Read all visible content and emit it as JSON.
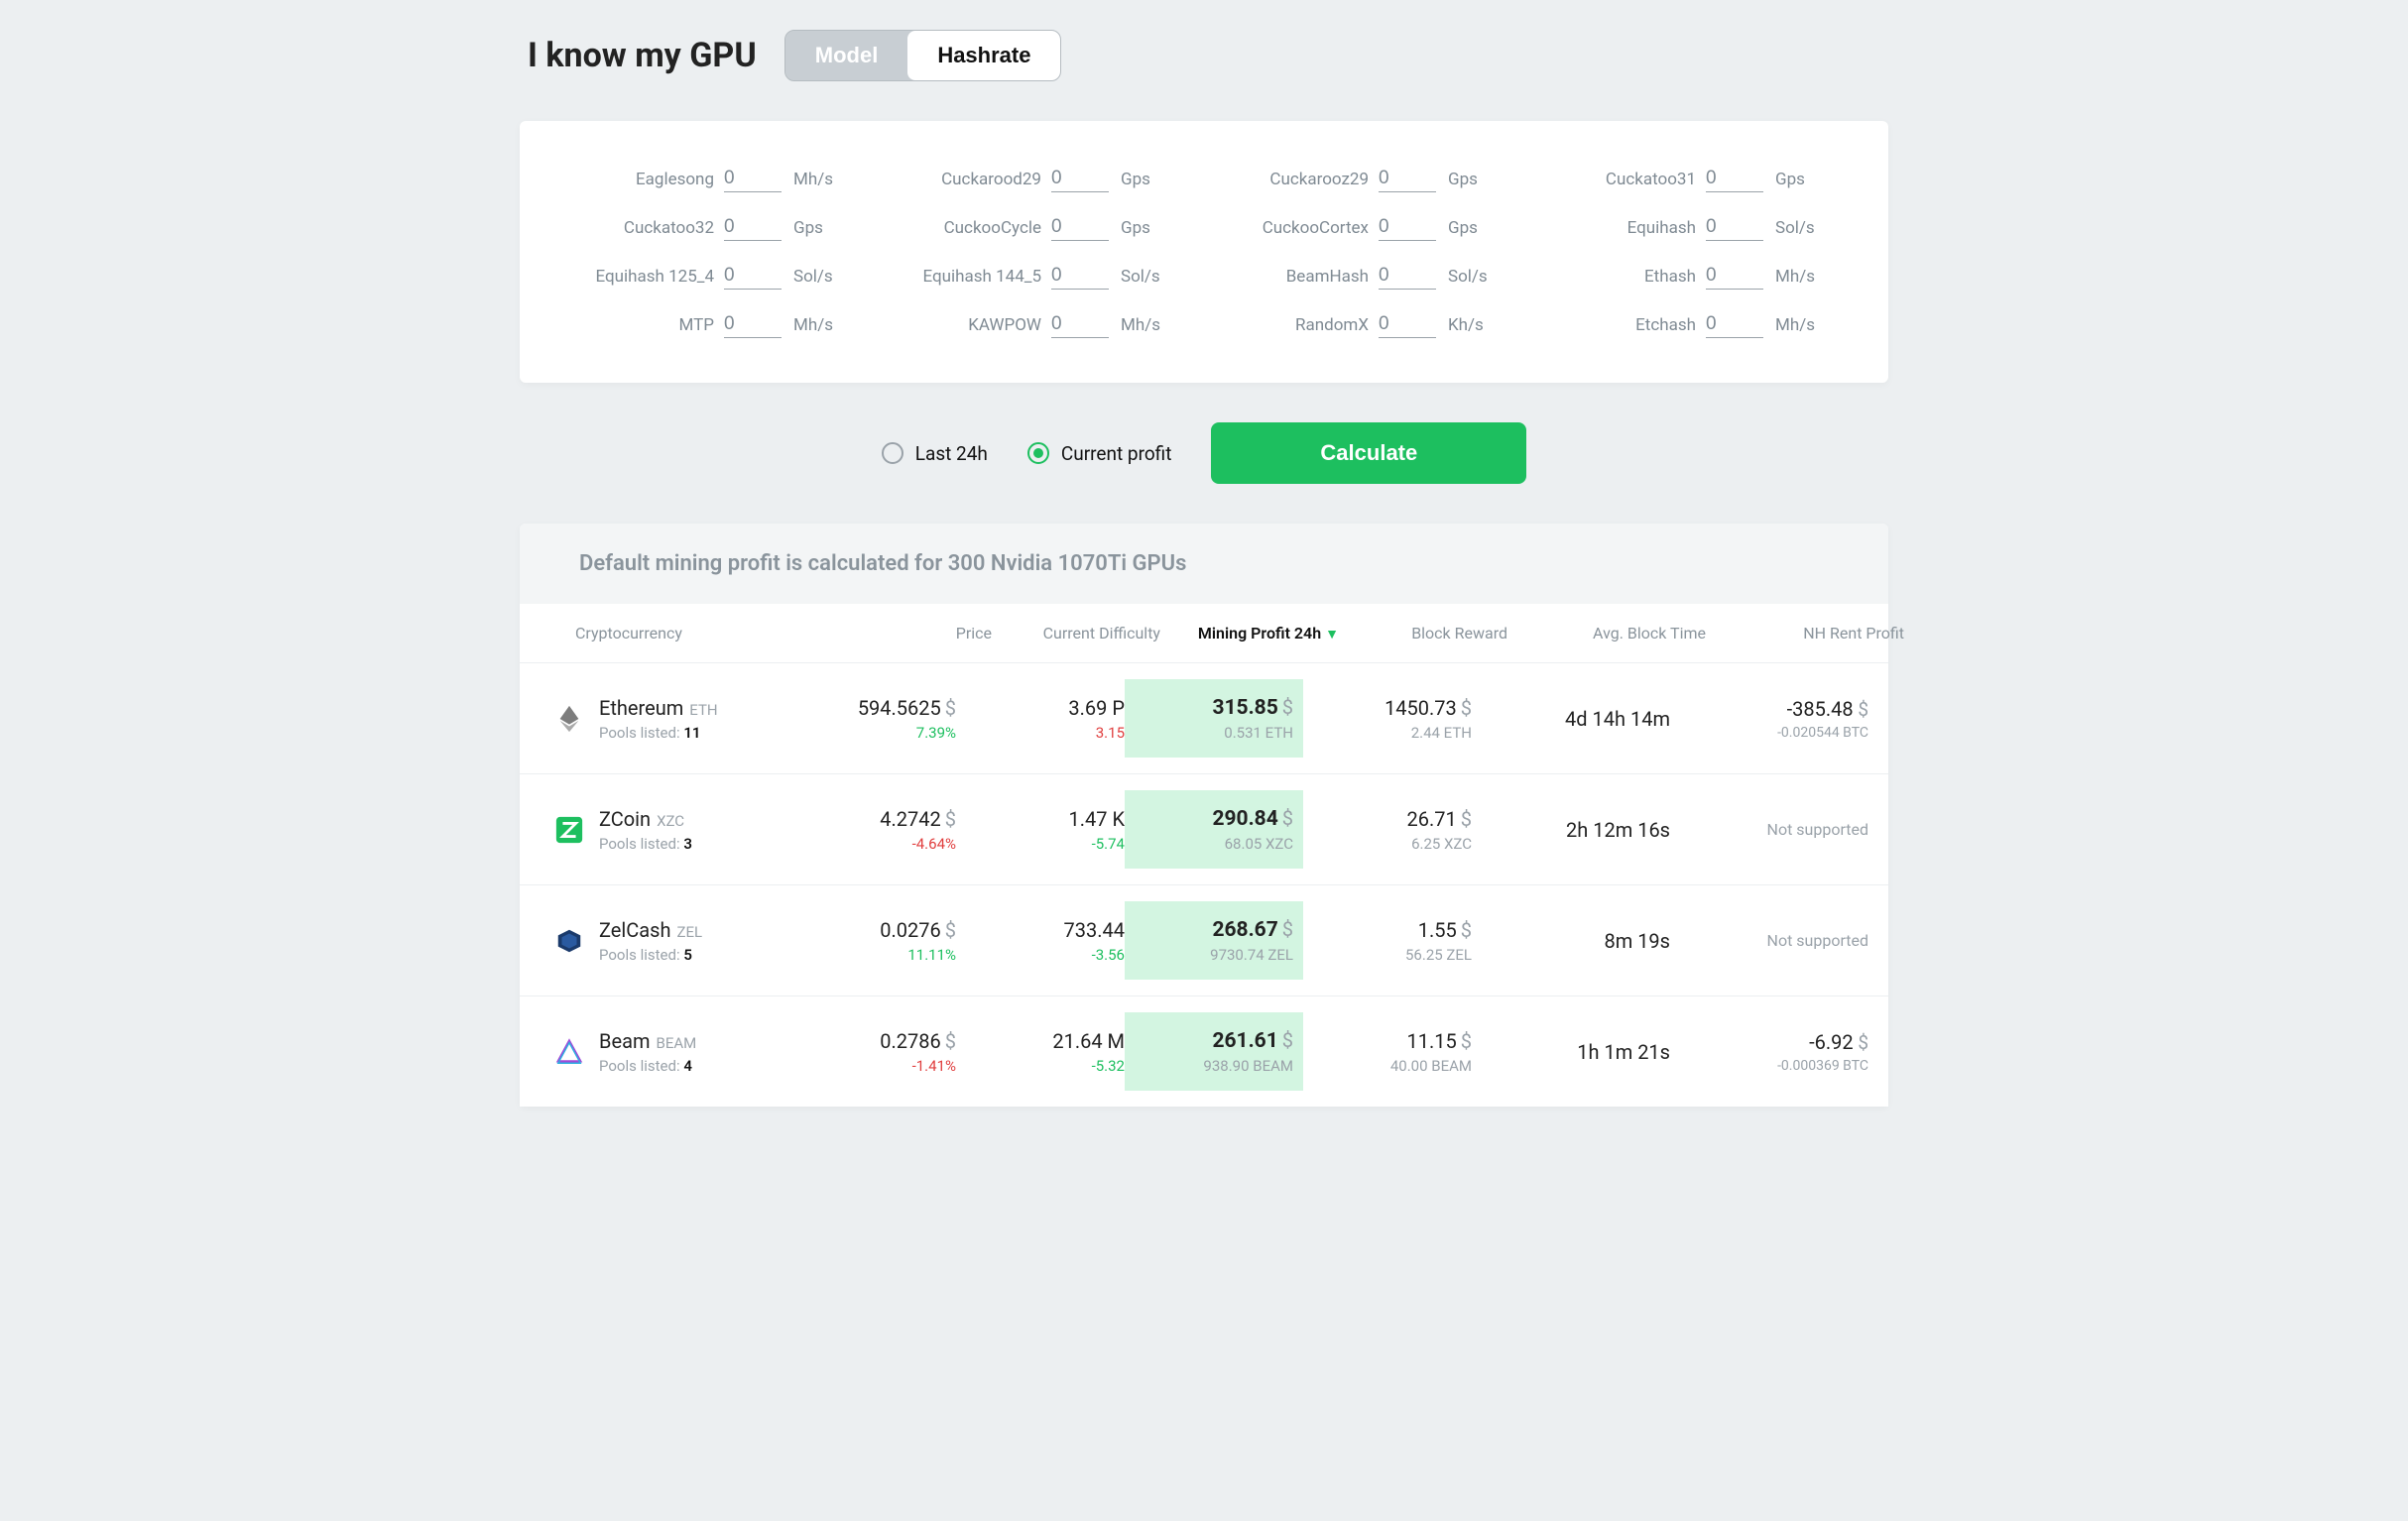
{
  "title": "I know my GPU",
  "toggle": {
    "model": "Model",
    "hashrate": "Hashrate"
  },
  "hashrate_inputs": [
    {
      "label": "Eaglesong",
      "value": "0",
      "unit": "Mh/s"
    },
    {
      "label": "Cuckarood29",
      "value": "0",
      "unit": "Gps"
    },
    {
      "label": "Cuckarooz29",
      "value": "0",
      "unit": "Gps"
    },
    {
      "label": "Cuckatoo31",
      "value": "0",
      "unit": "Gps"
    },
    {
      "label": "Cuckatoo32",
      "value": "0",
      "unit": "Gps"
    },
    {
      "label": "CuckooCycle",
      "value": "0",
      "unit": "Gps"
    },
    {
      "label": "CuckooCortex",
      "value": "0",
      "unit": "Gps"
    },
    {
      "label": "Equihash",
      "value": "0",
      "unit": "Sol/s"
    },
    {
      "label": "Equihash 125_4",
      "value": "0",
      "unit": "Sol/s"
    },
    {
      "label": "Equihash 144_5",
      "value": "0",
      "unit": "Sol/s"
    },
    {
      "label": "BeamHash",
      "value": "0",
      "unit": "Sol/s"
    },
    {
      "label": "Ethash",
      "value": "0",
      "unit": "Mh/s"
    },
    {
      "label": "MTP",
      "value": "0",
      "unit": "Mh/s"
    },
    {
      "label": "KAWPOW",
      "value": "0",
      "unit": "Mh/s"
    },
    {
      "label": "RandomX",
      "value": "0",
      "unit": "Kh/s"
    },
    {
      "label": "Etchash",
      "value": "0",
      "unit": "Mh/s"
    }
  ],
  "radio": {
    "last24h": "Last 24h",
    "current": "Current profit"
  },
  "calculate": "Calculate",
  "info_bar": "Default mining profit is calculated for 300 Nvidia 1070Ti GPUs",
  "columns": {
    "crypto": "Cryptocurrency",
    "price": "Price",
    "difficulty": "Current Difficulty",
    "profit": "Mining Profit 24h",
    "reward": "Block Reward",
    "blocktime": "Avg. Block Time",
    "nhrent": "NH Rent Profit"
  },
  "pools_label": "Pools listed:",
  "not_supported": "Not supported",
  "rows": [
    {
      "name": "Ethereum",
      "sym": "ETH",
      "pools": "11",
      "price": "594.5625",
      "price_change": "7.39%",
      "price_dir": "green",
      "diff": "3.69 P",
      "diff_change": "3.15",
      "diff_dir": "red",
      "profit": "315.85",
      "profit_sub": "0.531 ETH",
      "reward": "1450.73",
      "reward_sub": "2.44 ETH",
      "blocktime": "4d 14h 14m",
      "nh": "-385.48",
      "nh_sub": "-0.020544 BTC",
      "nh_supported": true
    },
    {
      "name": "ZCoin",
      "sym": "XZC",
      "pools": "3",
      "price": "4.2742",
      "price_change": "-4.64%",
      "price_dir": "red",
      "diff": "1.47 K",
      "diff_change": "-5.74",
      "diff_dir": "green",
      "profit": "290.84",
      "profit_sub": "68.05 XZC",
      "reward": "26.71",
      "reward_sub": "6.25 XZC",
      "blocktime": "2h 12m 16s",
      "nh": "",
      "nh_sub": "",
      "nh_supported": false
    },
    {
      "name": "ZelCash",
      "sym": "ZEL",
      "pools": "5",
      "price": "0.0276",
      "price_change": "11.11%",
      "price_dir": "green",
      "diff": "733.44",
      "diff_change": "-3.56",
      "diff_dir": "green",
      "profit": "268.67",
      "profit_sub": "9730.74 ZEL",
      "reward": "1.55",
      "reward_sub": "56.25 ZEL",
      "blocktime": "8m 19s",
      "nh": "",
      "nh_sub": "",
      "nh_supported": false
    },
    {
      "name": "Beam",
      "sym": "BEAM",
      "pools": "4",
      "price": "0.2786",
      "price_change": "-1.41%",
      "price_dir": "red",
      "diff": "21.64 M",
      "diff_change": "-5.32",
      "diff_dir": "green",
      "profit": "261.61",
      "profit_sub": "938.90 BEAM",
      "reward": "11.15",
      "reward_sub": "40.00 BEAM",
      "blocktime": "1h 1m 21s",
      "nh": "-6.92",
      "nh_sub": "-0.000369 BTC",
      "nh_supported": true
    }
  ]
}
